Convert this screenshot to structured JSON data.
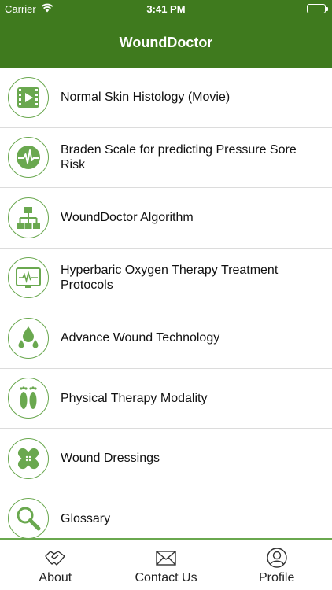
{
  "status_bar": {
    "carrier": "Carrier",
    "time": "3:41 PM"
  },
  "nav": {
    "title": "WoundDoctor"
  },
  "menu": [
    {
      "label": "Normal Skin Histology (Movie)",
      "icon": "video-icon"
    },
    {
      "label": "Braden Scale for predicting Pressure Sore Risk",
      "icon": "heartbeat-icon"
    },
    {
      "label": "WoundDoctor Algorithm",
      "icon": "flowchart-icon"
    },
    {
      "label": "Hyperbaric Oxygen Therapy Treatment Protocols",
      "icon": "monitor-icon"
    },
    {
      "label": "Advance Wound Technology",
      "icon": "drops-icon"
    },
    {
      "label": "Physical Therapy Modality",
      "icon": "footprints-icon"
    },
    {
      "label": "Wound Dressings",
      "icon": "bandage-icon"
    },
    {
      "label": "Glossary",
      "icon": "magnifier-icon"
    }
  ],
  "tabs": [
    {
      "label": "About",
      "icon": "handshake-icon"
    },
    {
      "label": "Contact Us",
      "icon": "envelope-icon"
    },
    {
      "label": "Profile",
      "icon": "user-icon"
    }
  ],
  "colors": {
    "header": "#3f7a1e",
    "icon_green": "#6aa84f"
  }
}
